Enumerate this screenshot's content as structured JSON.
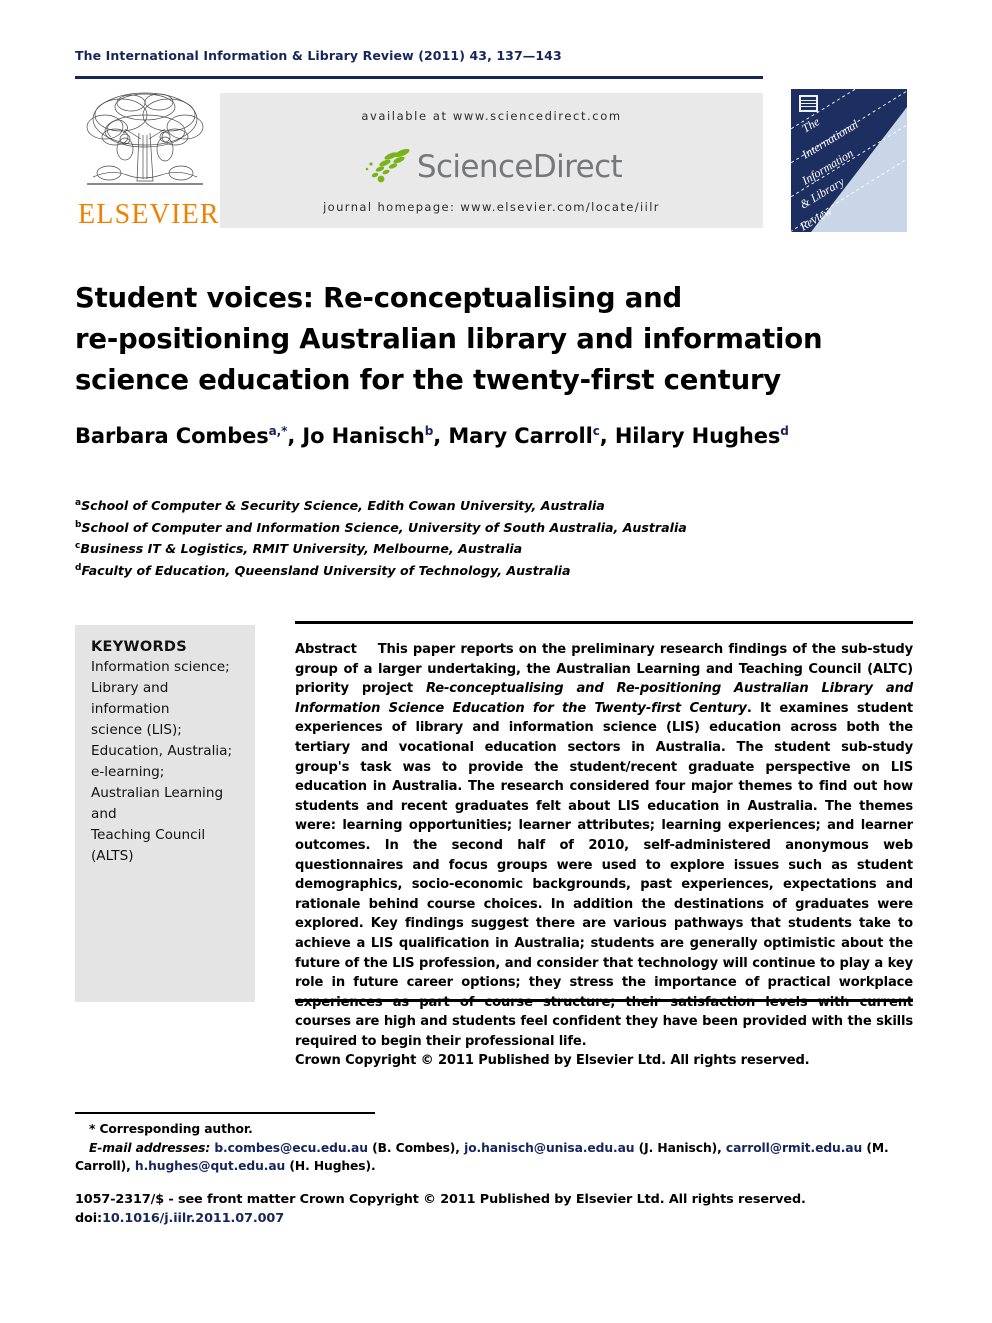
{
  "running_head": "The International Information & Library Review (2011) 43, 137—143",
  "masthead": {
    "publisher_name": "ELSEVIER",
    "available_at": "available at www.sciencedirect.com",
    "sciencedirect_label": "ScienceDirect",
    "journal_homepage": "journal homepage: www.elsevier.com/locate/iilr",
    "cover_lines": [
      "The",
      "International",
      "Information",
      "& Library",
      "Review"
    ],
    "cover_bg_color": "#1d2f60",
    "banner_bg_color": "#e9e9e9",
    "elsevier_color": "#f08000"
  },
  "article": {
    "title_line1": "Student voices: Re-conceptualising and",
    "title_line2": "re-positioning Australian library and information",
    "title_line3": "science education for the twenty-first century",
    "authors": [
      {
        "name": "Barbara Combes",
        "marks": "a,*"
      },
      {
        "name": "Jo Hanisch",
        "marks": "b"
      },
      {
        "name": "Mary Carroll",
        "marks": "c"
      },
      {
        "name": "Hilary Hughes",
        "marks": "d"
      }
    ],
    "affiliations": [
      {
        "mark": "a",
        "text": "School of Computer & Security Science, Edith Cowan University, Australia"
      },
      {
        "mark": "b",
        "text": "School of Computer and Information Science, University of South Australia, Australia"
      },
      {
        "mark": "c",
        "text": "Business IT & Logistics, RMIT University, Melbourne, Australia"
      },
      {
        "mark": "d",
        "text": "Faculty of Education, Queensland University of Technology, Australia"
      }
    ]
  },
  "keywords": {
    "heading": "KEYWORDS",
    "items": [
      "Information science;",
      "Library and information",
      "science (LIS);",
      "Education, Australia;",
      "e-learning;",
      "Australian Learning and",
      "Teaching Council (ALTS)"
    ]
  },
  "abstract": {
    "label": "Abstract",
    "part1": "This paper reports on the preliminary research findings of the sub-study group of a larger undertaking, the Australian Learning and Teaching Council (ALTC) priority project ",
    "italic_title": "Re-conceptualising and Re-positioning Australian Library and Information Science Education for the Twenty-first Century",
    "part2": ". It examines student experiences of library and information science (LIS) education across both the tertiary and vocational education sectors in Australia. The student sub-study group's task was to provide the student/recent graduate perspective on LIS education in Australia. The research considered four major themes to find out how students and recent graduates felt about LIS education in Australia. The themes were: learning opportunities; learner attributes; learning experiences; and learner outcomes. In the second half of 2010, self-administered anonymous web questionnaires and focus groups were used to explore issues such as student demographics, socio-economic backgrounds, past experiences, expectations and rationale behind course choices. In addition the destinations of graduates were explored. Key findings suggest there are various pathways that students take to achieve a LIS qualification in Australia; students are generally optimistic about the future of the LIS profession, and consider that technology will continue to play a key role in future career options; they stress the importance of practical workplace experiences as part of course structure; their satisfaction levels with current courses are high and students feel confident they have been provided with the skills required to begin their professional life.",
    "copyright": "Crown Copyright © 2011 Published by Elsevier Ltd. All rights reserved."
  },
  "footnotes": {
    "corresponding": "* Corresponding author.",
    "email_label": "E-mail addresses:",
    "emails": [
      {
        "address": "b.combes@ecu.edu.au",
        "owner": "(B. Combes),"
      },
      {
        "address": "jo.hanisch@unisa.edu.au",
        "owner": "(J. Hanisch),"
      },
      {
        "address": "carroll@rmit.edu.au",
        "owner": "(M. Carroll),"
      },
      {
        "address": "h.hughes@qut.edu.au",
        "owner": "(H. Hughes)."
      }
    ],
    "issn_line": "1057-2317/$ - see front matter Crown Copyright © 2011 Published by Elsevier Ltd. All rights reserved.",
    "doi_prefix": "doi:",
    "doi_value": "10.1016/j.iilr.2011.07.007",
    "link_color": "#16255c"
  }
}
